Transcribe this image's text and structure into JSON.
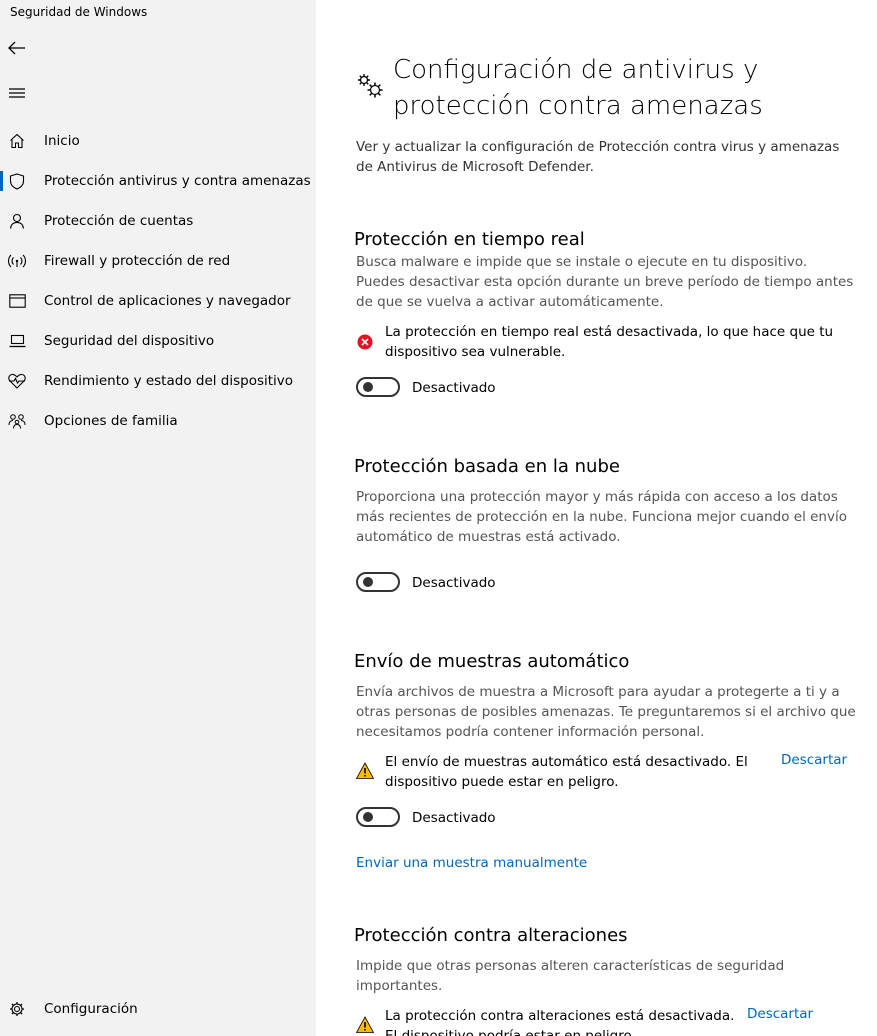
{
  "window": {
    "title": "Seguridad de Windows"
  },
  "sidebar": {
    "items": [
      {
        "label": "Inicio",
        "icon": "home-icon"
      },
      {
        "label": "Protección antivirus y contra amenazas",
        "icon": "shield-icon"
      },
      {
        "label": "Protección de cuentas",
        "icon": "person-icon"
      },
      {
        "label": "Firewall y protección de red",
        "icon": "wifi-icon"
      },
      {
        "label": "Control de aplicaciones y navegador",
        "icon": "browser-icon"
      },
      {
        "label": "Seguridad del dispositivo",
        "icon": "laptop-icon"
      },
      {
        "label": "Rendimiento y estado del dispositivo",
        "icon": "heart-icon"
      },
      {
        "label": "Opciones de familia",
        "icon": "family-icon"
      }
    ],
    "settings_label": "Configuración",
    "accent_color": "#0067c0"
  },
  "main": {
    "title": "Configuración de antivirus y protección contra amenazas",
    "description": "Ver y actualizar la configuración de Protección contra virus y amenazas de Antivirus de Microsoft Defender.",
    "sections": {
      "realtime": {
        "title": "Protección en tiempo real",
        "description": "Busca malware e impide que se instale o ejecute en tu dispositivo. Puedes desactivar esta opción durante un breve período de tiempo antes de que se vuelva a activar automáticamente.",
        "alert": "La protección en tiempo real está desactivada, lo que hace que tu dispositivo sea vulnerable.",
        "toggle_label": "Desactivado"
      },
      "cloud": {
        "title": "Protección basada en la nube",
        "description": "Proporciona una protección mayor y más rápida con acceso a los datos más recientes de protección en la nube. Funciona mejor cuando el envío automático de muestras está activado.",
        "toggle_label": "Desactivado"
      },
      "samples": {
        "title": "Envío de muestras automático",
        "description": "Envía archivos de muestra a Microsoft para ayudar a protegerte a ti y a otras personas de posibles amenazas. Te preguntaremos si el archivo que necesitamos podría contener información personal.",
        "alert": "El envío de muestras automático está desactivado. El dispositivo puede estar en peligro.",
        "dismiss": "Descartar",
        "toggle_label": "Desactivado",
        "manual_link": "Enviar una muestra manualmente"
      },
      "tamper": {
        "title": "Protección contra alteraciones",
        "description": "Impide que otras personas alteren características de seguridad importantes.",
        "alert": "La protección contra alteraciones está desactivada. El dispositivo podría estar en peligro.",
        "dismiss": "Descartar"
      }
    },
    "colors": {
      "error": "#e81123",
      "warning": "#ffb900",
      "link": "#0067c0"
    }
  }
}
